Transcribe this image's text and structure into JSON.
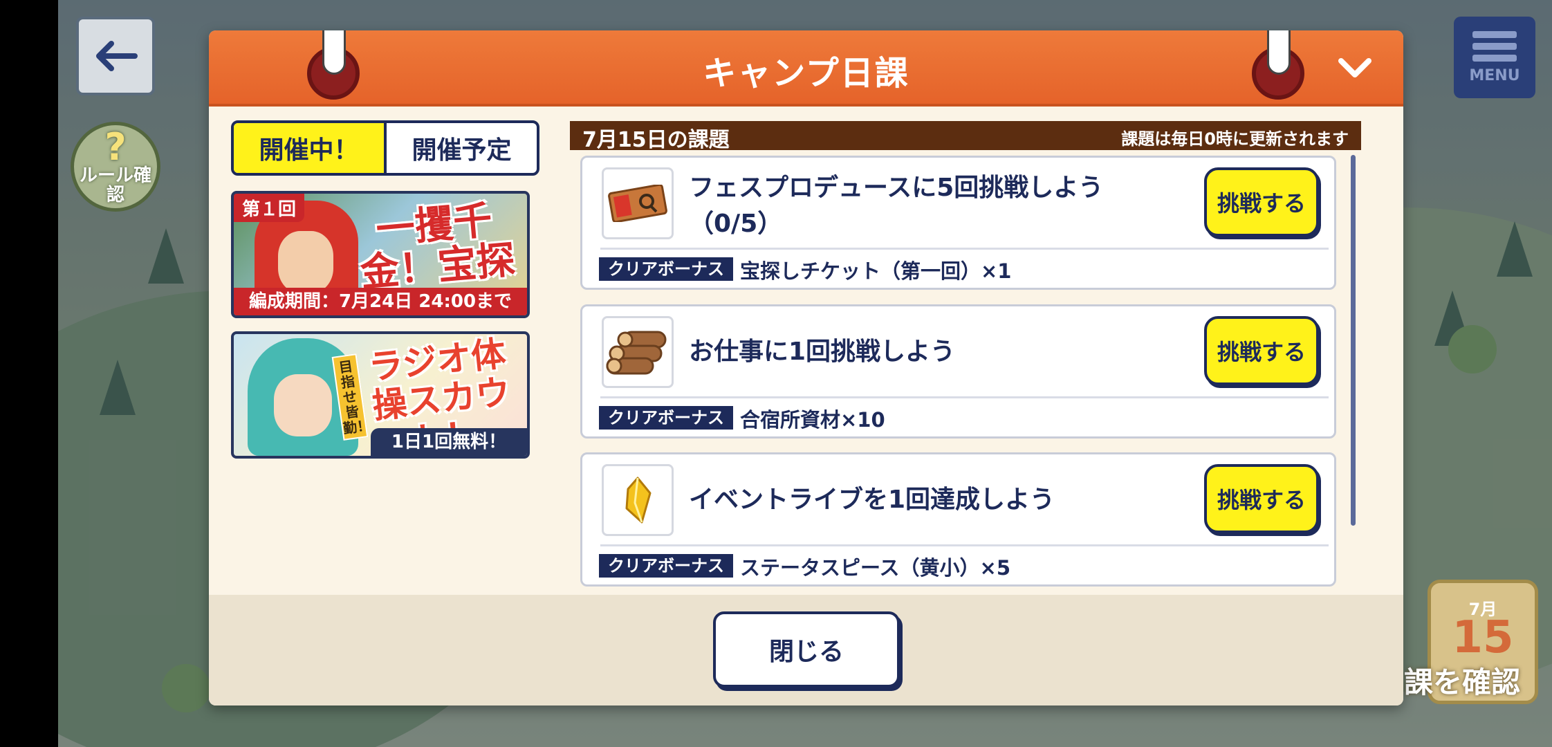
{
  "background": {
    "menu_label": "MENU",
    "rule_button_label": "ルール確認",
    "calendar": {
      "month": "7月",
      "day": "15",
      "label": "課を確認"
    }
  },
  "dialog": {
    "title": "キャンプ日課",
    "tabs": [
      {
        "label": "開催中！",
        "active": true
      },
      {
        "label": "開催予定",
        "active": false
      }
    ],
    "banners": [
      {
        "badge": "第１回",
        "logo": "一攫千金！宝探し！",
        "footer": "編成期間：7月24日 24:00まで"
      },
      {
        "tag": "目指せ皆勤！",
        "logo": "ラジオ体操スカウト！",
        "footer": "1日1回無料！"
      }
    ],
    "date_header": {
      "date": "7月15日の課題",
      "note": "課題は毎日0時に更新されます"
    },
    "tasks": [
      {
        "title": "フェスプロデュースに5回挑戦しよう（0/5）",
        "bonus_tag": "クリアボーナス",
        "bonus": "宝探しチケット（第一回）×1",
        "button": "挑戦する",
        "icon": "ticket-icon"
      },
      {
        "title": "お仕事に1回挑戦しよう",
        "bonus_tag": "クリアボーナス",
        "bonus": "合宿所資材×10",
        "button": "挑戦する",
        "icon": "logs-icon"
      },
      {
        "title": "イベントライブを1回達成しよう",
        "bonus_tag": "クリアボーナス",
        "bonus": "ステータスピース（黄小）×5",
        "button": "挑戦する",
        "icon": "yellow-gem-icon"
      }
    ],
    "close_label": "閉じる"
  },
  "colors": {
    "header": "#e5632a",
    "navy": "#1d2a5a",
    "yellow": "#fff21a",
    "date_bar": "#5c2d10"
  }
}
